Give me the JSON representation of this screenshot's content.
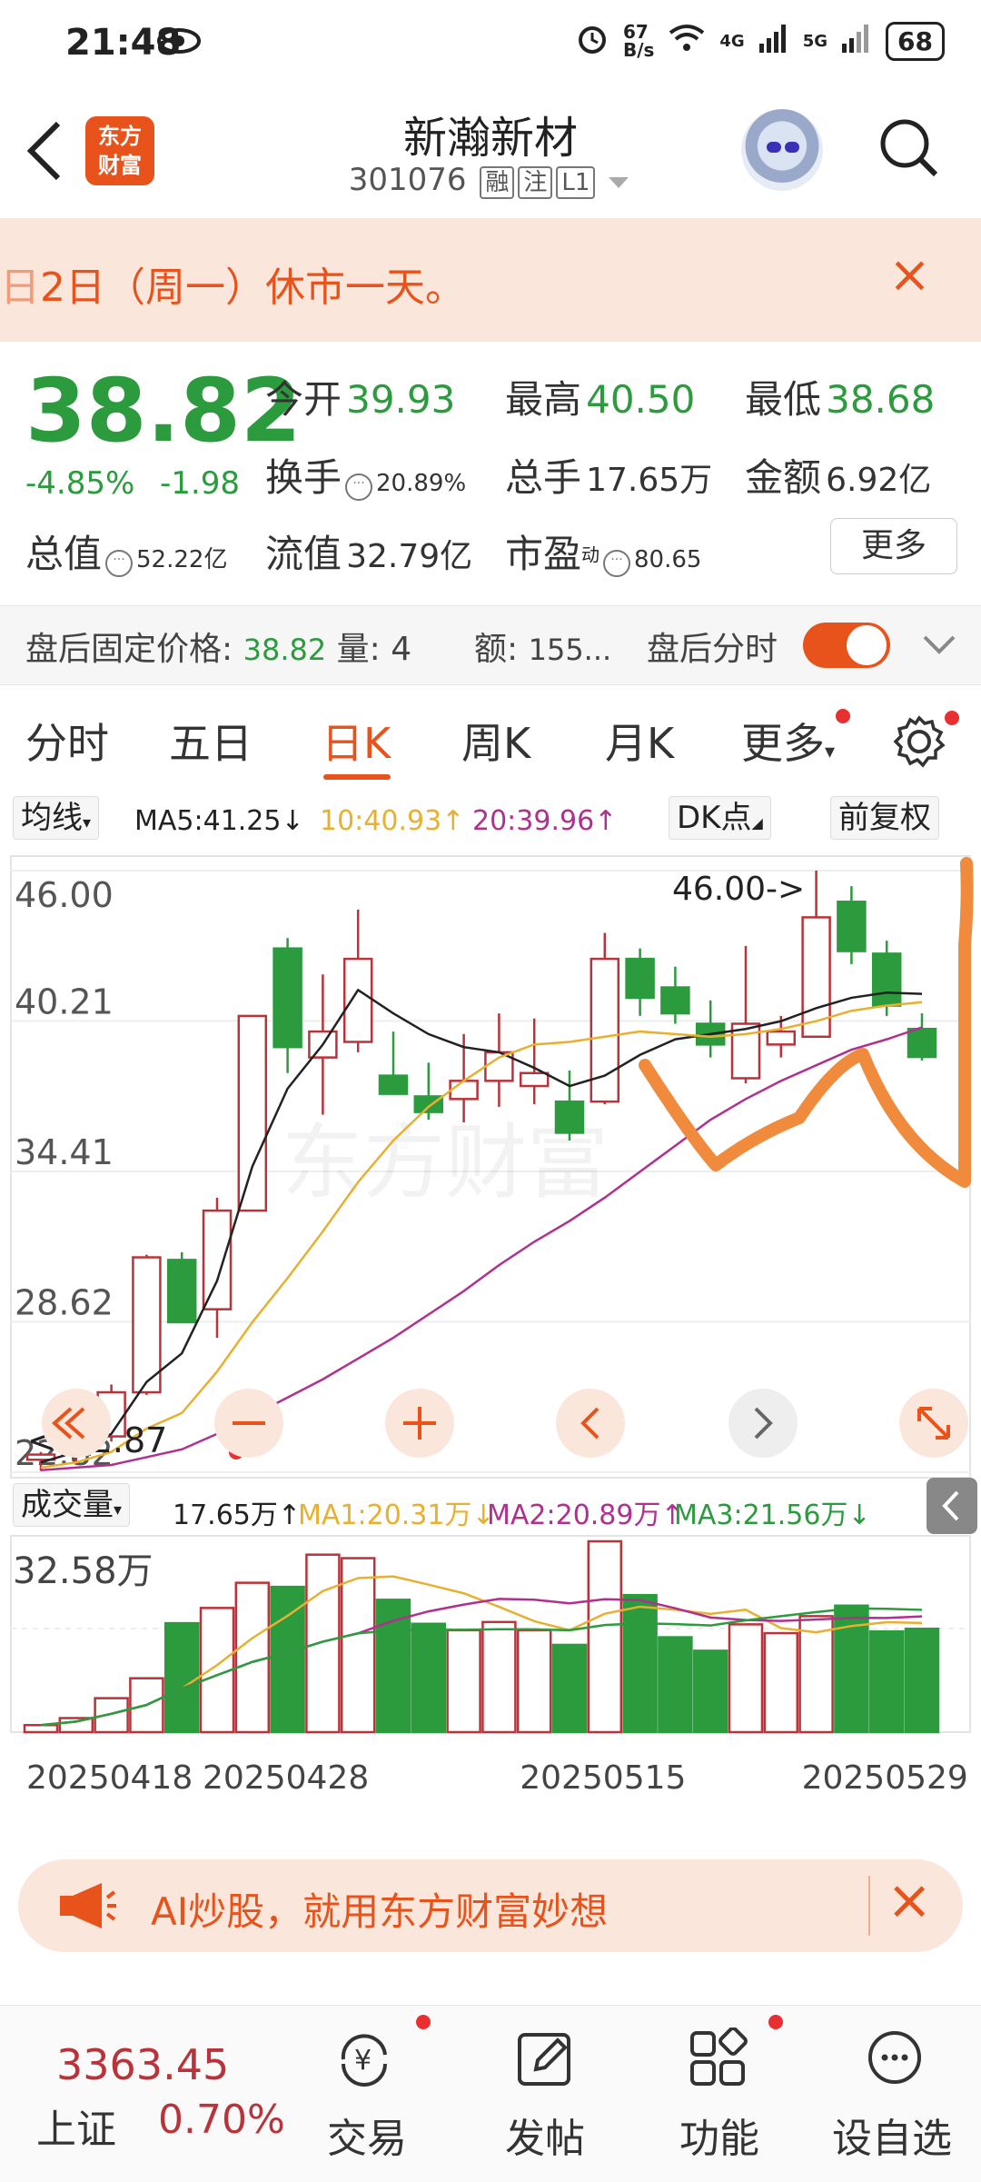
{
  "status": {
    "time": "21:48",
    "net_speed_top": "67",
    "net_speed_bottom": "B/s",
    "battery": "68",
    "signal_1": "4G",
    "signal_2": "5G"
  },
  "header": {
    "back_icon": "chevron-left-icon",
    "logo_text_1": "东方",
    "logo_text_2": "财富",
    "stock_name": "新瀚新材",
    "stock_code": "301076",
    "tags": [
      "融",
      "注",
      "L1"
    ]
  },
  "notice": {
    "text": "2日（周一）休市一天。",
    "close": "×"
  },
  "quote": {
    "price": "38.82",
    "change_pct": "-4.85%",
    "change_amt": "-1.98",
    "open_label": "今开",
    "open_value": "39.93",
    "high_label": "最高",
    "high_value": "40.50",
    "low_label": "最低",
    "low_value": "38.68",
    "turnover_label": "换手",
    "turnover_value": "20.89%",
    "volume_label": "总手",
    "volume_value": "17.65万",
    "amount_label": "金额",
    "amount_value": "6.92亿",
    "mktcap_label": "总值",
    "mktcap_value": "52.22亿",
    "float_label": "流值",
    "float_value": "32.79亿",
    "pe_label": "市盈",
    "pe_super": "动",
    "pe_value": "80.65",
    "more_label": "更多"
  },
  "after_hours": {
    "label": "盘后固定价格:",
    "price": "38.82",
    "vol_label": "量:",
    "vol_value": "4",
    "amt_label": "额:",
    "amt_value": "155...",
    "timeshare_label": "盘后分时",
    "toggle_on": true
  },
  "tabs": [
    "分时",
    "五日",
    "日K",
    "周K",
    "月K",
    "更多"
  ],
  "active_tab": "日K",
  "ma_bar": {
    "selector": "均线",
    "ma5": "MA5:41.25↓",
    "ma10": "10:40.93↑",
    "ma20": "20:39.96↑",
    "dk": "DK点",
    "adjust": "前复权",
    "colors": {
      "ma5": "#222222",
      "ma10": "#e8b030",
      "ma20": "#b03090"
    }
  },
  "vol_bar": {
    "selector": "成交量",
    "vol": "17.65万↑",
    "ma1": "MA1:20.31万↓",
    "ma2": "MA2:20.89万↑",
    "ma3": "MA3:21.56万↓",
    "colors": {
      "ma1": "#e8b030",
      "ma2": "#b03090",
      "ma3": "#2b9b3e"
    }
  },
  "chart_data": {
    "type": "candlestick",
    "y_ticks": [
      "46.00",
      "40.21",
      "34.41",
      "28.62",
      "22.82"
    ],
    "ylim": [
      22.82,
      46.0
    ],
    "max_label": "46.00->",
    "min_label": "<-22.87",
    "vol_max_label": "32.58万",
    "vol_ylim": [
      0,
      32.58
    ],
    "x_labels": [
      "20250418",
      "20250428",
      "20250515",
      "20250529"
    ],
    "candles": [
      {
        "o": 23.3,
        "h": 23.6,
        "l": 22.87,
        "c": 23.5
      },
      {
        "o": 23.5,
        "h": 24.4,
        "l": 23.1,
        "c": 24.2
      },
      {
        "o": 24.2,
        "h": 26.2,
        "l": 24.0,
        "c": 25.9
      },
      {
        "o": 25.9,
        "h": 31.2,
        "l": 25.8,
        "c": 31.1
      },
      {
        "o": 31.0,
        "h": 31.3,
        "l": 28.6,
        "c": 28.6
      },
      {
        "o": 29.1,
        "h": 33.4,
        "l": 28.0,
        "c": 32.9
      },
      {
        "o": 32.9,
        "h": 40.4,
        "l": 32.9,
        "c": 40.4
      },
      {
        "o": 43.0,
        "h": 43.4,
        "l": 38.2,
        "c": 39.2
      },
      {
        "o": 38.8,
        "h": 42.0,
        "l": 36.6,
        "c": 39.8
      },
      {
        "o": 39.4,
        "h": 44.5,
        "l": 39.0,
        "c": 42.6
      },
      {
        "o": 38.1,
        "h": 39.8,
        "l": 37.6,
        "c": 37.4
      },
      {
        "o": 37.3,
        "h": 38.6,
        "l": 36.4,
        "c": 36.7
      },
      {
        "o": 37.2,
        "h": 39.7,
        "l": 36.3,
        "c": 37.9
      },
      {
        "o": 37.9,
        "h": 40.5,
        "l": 36.9,
        "c": 39.0
      },
      {
        "o": 37.7,
        "h": 40.3,
        "l": 37.0,
        "c": 38.2
      },
      {
        "o": 37.1,
        "h": 38.3,
        "l": 35.6,
        "c": 35.9
      },
      {
        "o": 37.1,
        "h": 43.6,
        "l": 37.0,
        "c": 42.6
      },
      {
        "o": 42.6,
        "h": 43.0,
        "l": 40.4,
        "c": 41.1
      },
      {
        "o": 41.5,
        "h": 42.3,
        "l": 40.1,
        "c": 40.5
      },
      {
        "o": 40.1,
        "h": 41.0,
        "l": 38.8,
        "c": 39.3
      },
      {
        "o": 38.0,
        "h": 43.1,
        "l": 37.8,
        "c": 40.1
      },
      {
        "o": 39.3,
        "h": 40.4,
        "l": 38.8,
        "c": 39.8
      },
      {
        "o": 39.6,
        "h": 46.0,
        "l": 39.6,
        "c": 44.2
      },
      {
        "o": 44.8,
        "h": 45.4,
        "l": 42.4,
        "c": 42.9
      },
      {
        "o": 42.8,
        "h": 43.3,
        "l": 40.4,
        "c": 40.8
      },
      {
        "o": 39.9,
        "h": 40.5,
        "l": 38.68,
        "c": 38.82
      }
    ],
    "volumes": [
      1.2,
      2.4,
      5.8,
      9.2,
      18.6,
      21.2,
      25.5,
      24.8,
      30.3,
      29.7,
      22.6,
      18.5,
      17.4,
      18.8,
      17.4,
      14.9,
      32.58,
      23.4,
      16.2,
      13.9,
      18.4,
      16.9,
      19.8,
      21.6,
      17.2,
      17.65
    ],
    "ma_lines": {
      "ma5": [
        23.2,
        23.6,
        24.3,
        26.3,
        27.4,
        30.2,
        34.6,
        37.6,
        39.3,
        41.4,
        40.5,
        39.7,
        39.2,
        39.0,
        38.4,
        37.7,
        38.1,
        38.9,
        39.5,
        39.7,
        39.9,
        40.2,
        40.7,
        41.1,
        41.3,
        41.25
      ],
      "ma10": [
        23.0,
        23.2,
        23.6,
        24.5,
        25.1,
        26.7,
        28.6,
        30.3,
        32.1,
        34.0,
        35.6,
        36.9,
        37.9,
        38.8,
        39.3,
        39.4,
        39.6,
        39.8,
        39.7,
        39.6,
        39.7,
        39.9,
        40.2,
        40.6,
        40.8,
        40.93
      ],
      "ma20": [
        22.9,
        23.0,
        23.1,
        23.4,
        23.7,
        24.3,
        25.0,
        25.7,
        26.4,
        27.2,
        28.0,
        28.9,
        29.8,
        30.8,
        31.7,
        32.5,
        33.4,
        34.4,
        35.4,
        36.4,
        37.2,
        37.9,
        38.5,
        39.1,
        39.5,
        39.96
      ]
    }
  },
  "chart_controls": [
    "rewind-icon",
    "minus-icon",
    "plus-icon",
    "prev-icon",
    "next-icon",
    "expand-icon"
  ],
  "ad": {
    "text": "AI炒股，就用东方财富妙想",
    "close": "×"
  },
  "bottom_nav": {
    "index_value": "3363.45",
    "index_name": "上证",
    "index_change": "0.70%",
    "items": [
      {
        "label": "交易",
        "icon": "yen-cycle-icon"
      },
      {
        "label": "发帖",
        "icon": "edit-icon"
      },
      {
        "label": "功能",
        "icon": "grid-icon"
      },
      {
        "label": "设自选",
        "icon": "chat-bubble-icon"
      }
    ]
  },
  "colors": {
    "up": "#b8343a",
    "down": "#2b9b3e",
    "accent": "#e8531c",
    "annotation": "#f08a3c"
  }
}
